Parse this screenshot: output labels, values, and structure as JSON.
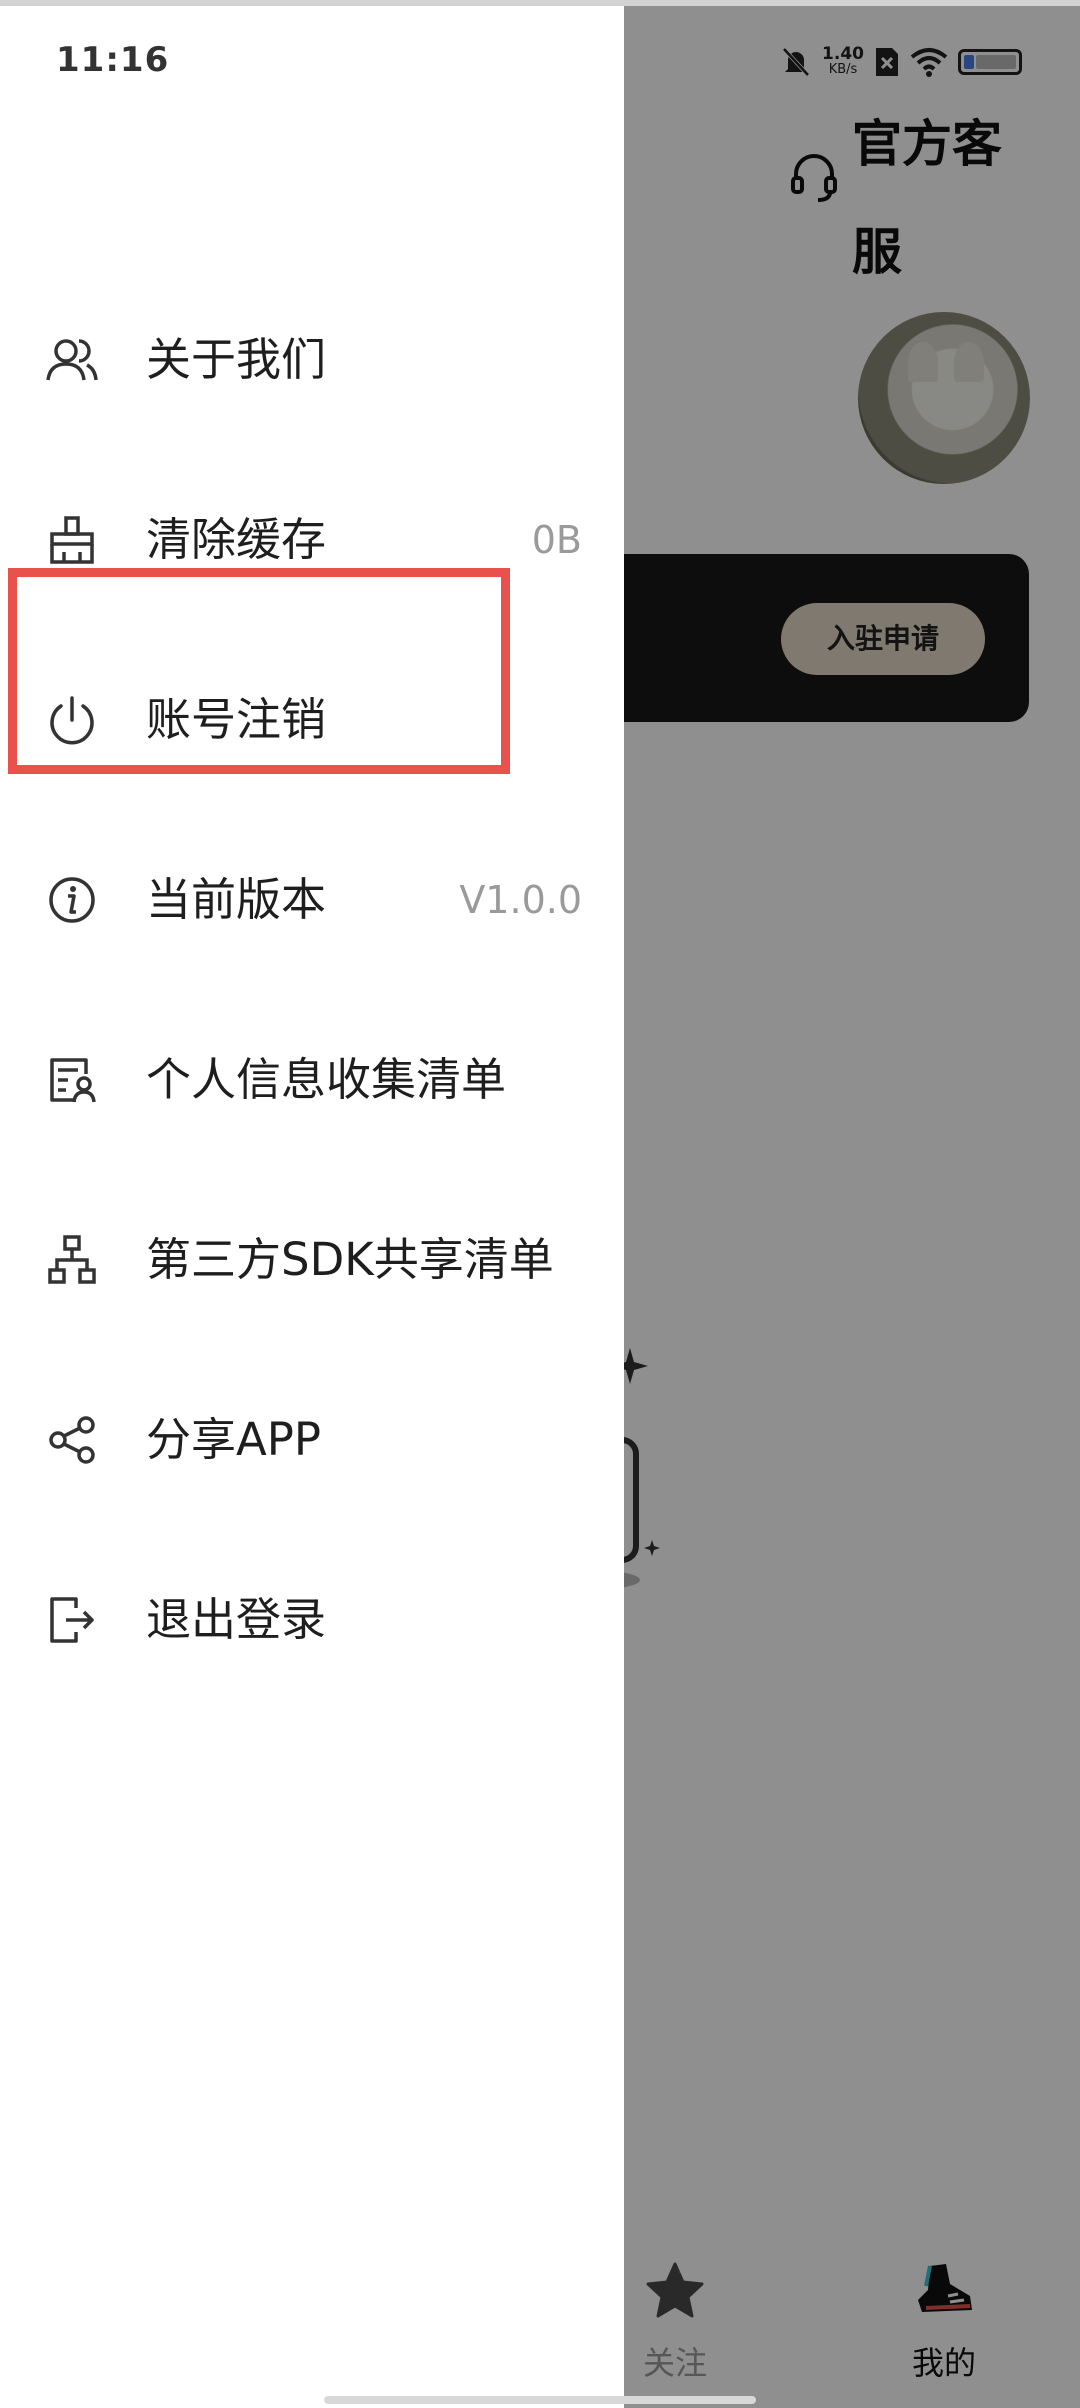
{
  "status_bar": {
    "time": "11:16",
    "net_speed": "1.40",
    "net_unit": "KB/s",
    "icons": [
      "mute-bell-icon",
      "no-sim-icon",
      "wifi-icon",
      "battery-icon"
    ]
  },
  "background": {
    "service_label": "官方客服",
    "apply_button": "入驻申请",
    "bottom_nav": [
      {
        "label": "关注",
        "icon": "star-icon",
        "active": false
      },
      {
        "label": "我的",
        "icon": "sneaker-icon",
        "active": true
      }
    ]
  },
  "drawer": {
    "menu": [
      {
        "label": "关于我们",
        "icon": "users-icon",
        "value": ""
      },
      {
        "label": "清除缓存",
        "icon": "broom-icon",
        "value": "0B"
      },
      {
        "label": "账号注销",
        "icon": "power-icon",
        "value": ""
      },
      {
        "label": "当前版本",
        "icon": "info-icon",
        "value": "V1.0.0"
      },
      {
        "label": "个人信息收集清单",
        "icon": "profile-list-icon",
        "value": ""
      },
      {
        "label": "第三方SDK共享清单",
        "icon": "hierarchy-icon",
        "value": ""
      },
      {
        "label": "分享APP",
        "icon": "share-icon",
        "value": ""
      },
      {
        "label": "退出登录",
        "icon": "logout-icon",
        "value": ""
      }
    ]
  },
  "colors": {
    "highlight": "#e8514c",
    "card_dark": "#181818",
    "apply_bg": "#e2d8c6"
  }
}
